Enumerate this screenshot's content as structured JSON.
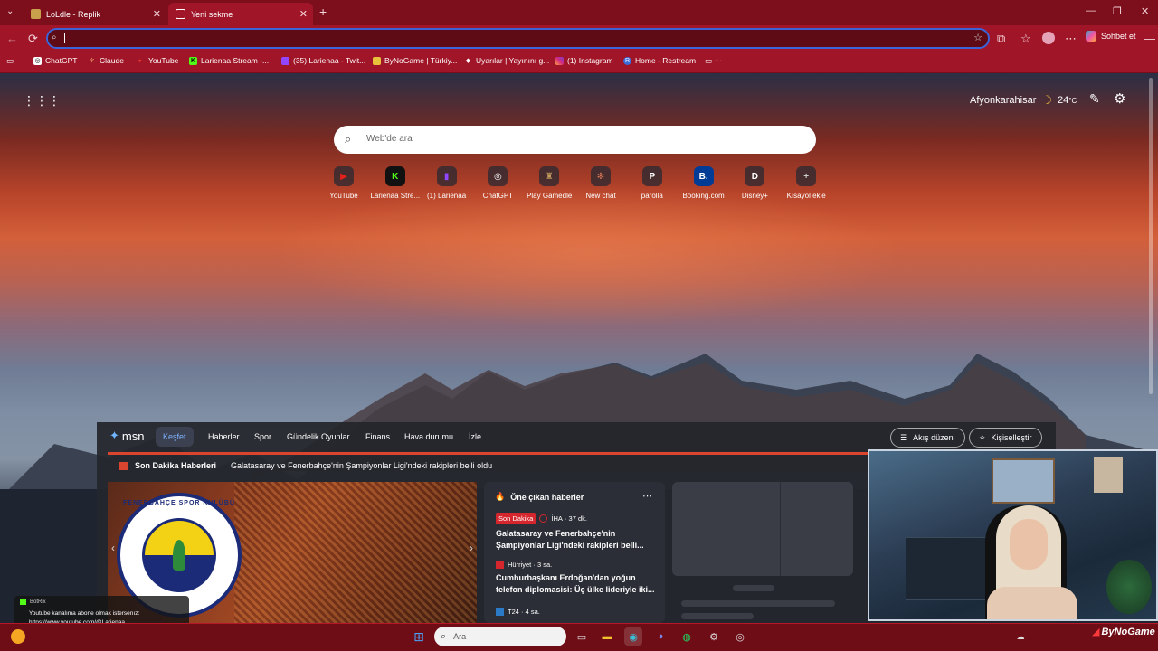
{
  "browser": {
    "tabs": [
      {
        "title": "LoLdle - Replik",
        "active": false
      },
      {
        "title": "Yeni sekme",
        "active": true
      }
    ],
    "address": "",
    "copilot_label": "Sohbet et",
    "bookmarks": [
      {
        "label": "ChatGPT",
        "icon": "chatgpt-icon"
      },
      {
        "label": "Claude",
        "icon": "claude-icon"
      },
      {
        "label": "YouTube",
        "icon": "youtube-icon"
      },
      {
        "label": "Larienaa Stream -...",
        "icon": "kick-icon"
      },
      {
        "label": "(35) Larienaa - Twit...",
        "icon": "twitch-icon"
      },
      {
        "label": "ByNoGame | Türkiy...",
        "icon": "bynogame-icon"
      },
      {
        "label": "Uyarılar | Yayınını g...",
        "icon": "streamlabs-icon"
      },
      {
        "label": "(1) Instagram",
        "icon": "instagram-icon"
      },
      {
        "label": "Home - Restream",
        "icon": "restream-icon"
      }
    ]
  },
  "newtab": {
    "weather": {
      "city": "Afyonkarahisar",
      "temp": "24",
      "unit": "°C"
    },
    "search_placeholder": "Web'de ara",
    "quick_links": [
      {
        "label": "YouTube",
        "icon": "youtube-icon",
        "color": "#e62117"
      },
      {
        "label": "Larienaa Stre...",
        "icon": "kick-icon",
        "color": "#53fc18"
      },
      {
        "label": "(1) Larienaa",
        "icon": "twitch-icon",
        "color": "#9146ff"
      },
      {
        "label": "ChatGPT",
        "icon": "chatgpt-icon",
        "color": "#ffffff"
      },
      {
        "label": "Play Gamedle",
        "icon": "gamedle-icon",
        "color": "#c8a060"
      },
      {
        "label": "New chat",
        "icon": "claude-icon",
        "color": "#d97757"
      },
      {
        "label": "parolla",
        "icon": "parolla-icon",
        "color": "#ffffff"
      },
      {
        "label": "Booking.com",
        "icon": "booking-icon",
        "color": "#003b95"
      },
      {
        "label": "Disney+",
        "icon": "disney-icon",
        "color": "#ffffff"
      },
      {
        "label": "Kısayol ekle",
        "icon": "plus-icon",
        "color": "#cccccc"
      }
    ]
  },
  "msn": {
    "logo": "msn",
    "nav": [
      "Keşfet",
      "Haberler",
      "Spor",
      "Gündelik Oyunlar",
      "Finans",
      "Hava durumu",
      "İzle"
    ],
    "feed_layout_button": "Akış düzeni",
    "personalize_button": "Kişiselleştir",
    "breaking_label": "Son Dakika Haberleri",
    "breaking_text": "Galatasaray ve Fenerbahçe'nin Şampiyonlar Ligi'ndeki rakipleri belli oldu",
    "hero_logo_text": "FENERBAHÇE SPOR KULÜBÜ",
    "top_stories_title": "Öne çıkan haberler",
    "stories": [
      {
        "badge": "Son Dakika",
        "source": "İHA",
        "time": "37 dk.",
        "headline": "Galatasaray ve Fenerbahçe'nin Şampiyonlar Ligi'ndeki rakipleri belli..."
      },
      {
        "badge": "",
        "source": "Hürriyet",
        "time": "3 sa.",
        "headline": "Cumhurbaşkanı Erdoğan'dan yoğun telefon diplomasisi: Üç ülke lideriyle iki..."
      },
      {
        "badge": "",
        "source": "T24",
        "time": "4 sa.",
        "headline": ""
      }
    ]
  },
  "overlay": {
    "bot_name": "BotRix",
    "message": "Youtube kanalıma abone olmak istersenız:",
    "link": "https://www.youtube.com/@Larienaa",
    "brand": "ByNoGame"
  },
  "taskbar": {
    "search_placeholder": "Ara"
  }
}
